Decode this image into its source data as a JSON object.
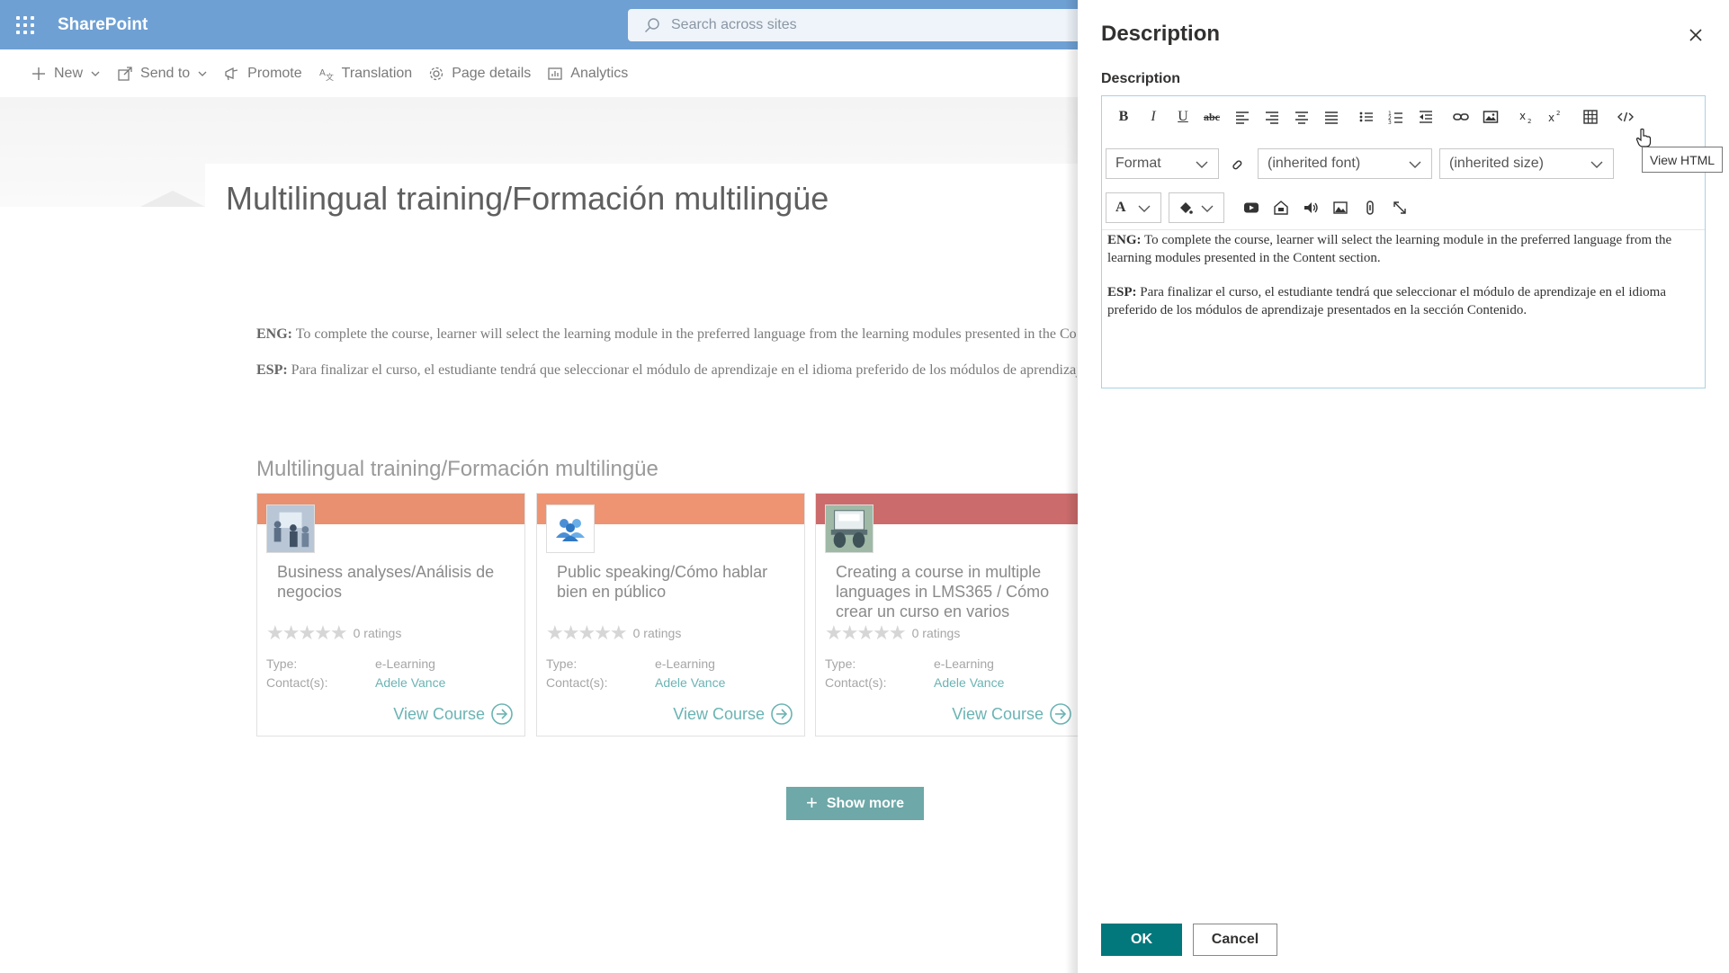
{
  "suitebar": {
    "brand": "SharePoint",
    "search_placeholder": "Search across sites",
    "bg_color": "#6ea0d4"
  },
  "commandbar": {
    "new": "New",
    "send_to": "Send to",
    "promote": "Promote",
    "translation": "Translation",
    "page_details": "Page details",
    "analytics": "Analytics"
  },
  "page": {
    "title": "Multilingual training/Formación multilingüe",
    "desc_eng_label": "ENG:",
    "desc_eng_text": " To complete the course, learner will select the learning module in the preferred language from the learning modules presented in the Content section.",
    "desc_esp_label": "ESP:",
    "desc_esp_text": " Para finalizar el curso, el estudiante tendrá que seleccionar el módulo de aprendizaje en el idioma preferido de los módulos de aprendizaje presentados en la sección Contenido.",
    "section_title": "Multilingual training/Formación multilingüe",
    "show_more": "Show more"
  },
  "cards": [
    {
      "title": "Business analyses/Análisis de negocios",
      "ratings": "0 ratings",
      "type_label": "Type:",
      "type_value": "e-Learning",
      "contact_label": "Contact(s):",
      "contact_value": "Adele Vance",
      "view": "View Course",
      "band_color": "#e8906f",
      "thumb_icon": "people-presentation-icon"
    },
    {
      "title": "Public speaking/Cómo hablar bien en público",
      "ratings": "0 ratings",
      "type_label": "Type:",
      "type_value": "e-Learning",
      "contact_label": "Contact(s):",
      "contact_value": "Adele Vance",
      "view": "View Course",
      "band_color": "#ee9472",
      "thumb_icon": "group-icon"
    },
    {
      "title": "Creating a course in multiple languages in LMS365 / Cómo crear un curso en varios",
      "ratings": "0 ratings",
      "type_label": "Type:",
      "type_value": "e-Learning",
      "contact_label": "Contact(s):",
      "contact_value": "Adele Vance",
      "view": "View Course",
      "band_color": "#cc6b6b",
      "thumb_icon": "laptop-hands-icon"
    }
  ],
  "panel": {
    "title": "Description",
    "field_label": "Description",
    "format_dd": "Format",
    "font_dd": "(inherited font)",
    "size_dd": "(inherited size)",
    "font_color_btn": "A",
    "tooltip": "View HTML",
    "body_eng_label": "ENG:",
    "body_eng_text": " To complete the course, learner will select the learning module in the preferred language from the learning modules presented in the Content section.",
    "body_esp_label": "ESP:",
    "body_esp_text": " Para finalizar el curso, el estudiante tendrá que seleccionar el módulo de aprendizaje en el idioma preferido de los módulos de aprendizaje presentados en la sección Contenido.",
    "ok": "OK",
    "cancel": "Cancel",
    "accent": "#03787c"
  }
}
